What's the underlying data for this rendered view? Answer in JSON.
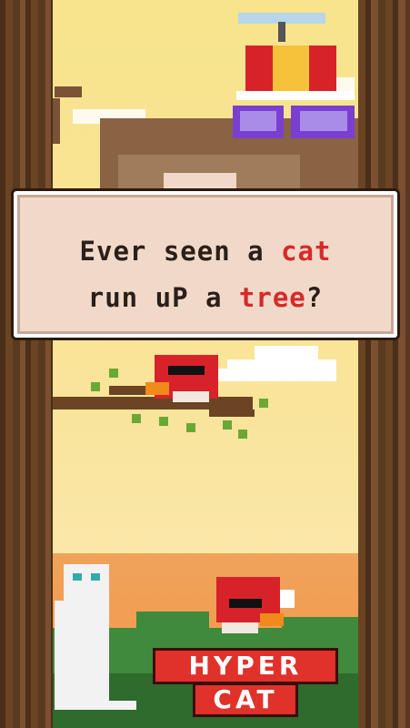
{
  "caption": {
    "line1_before": "Ever seen a ",
    "line1_highlight": "cat",
    "line2_before": "run uP a ",
    "line2_highlight": "tree",
    "line2_after": "?"
  },
  "logo": {
    "top": "HYPER",
    "bottom": "CAT"
  },
  "colors": {
    "highlight": "#d62a2a",
    "logo_red": "#e0312b",
    "sky_yellow": "#f7e48c",
    "sunset_orange": "#f39a50",
    "trunk_brown": "#5b3a1e",
    "bird_red": "#d8222a"
  },
  "characters": [
    "propeller-hat-cat",
    "red-bird",
    "white-cat",
    "red-bird"
  ]
}
